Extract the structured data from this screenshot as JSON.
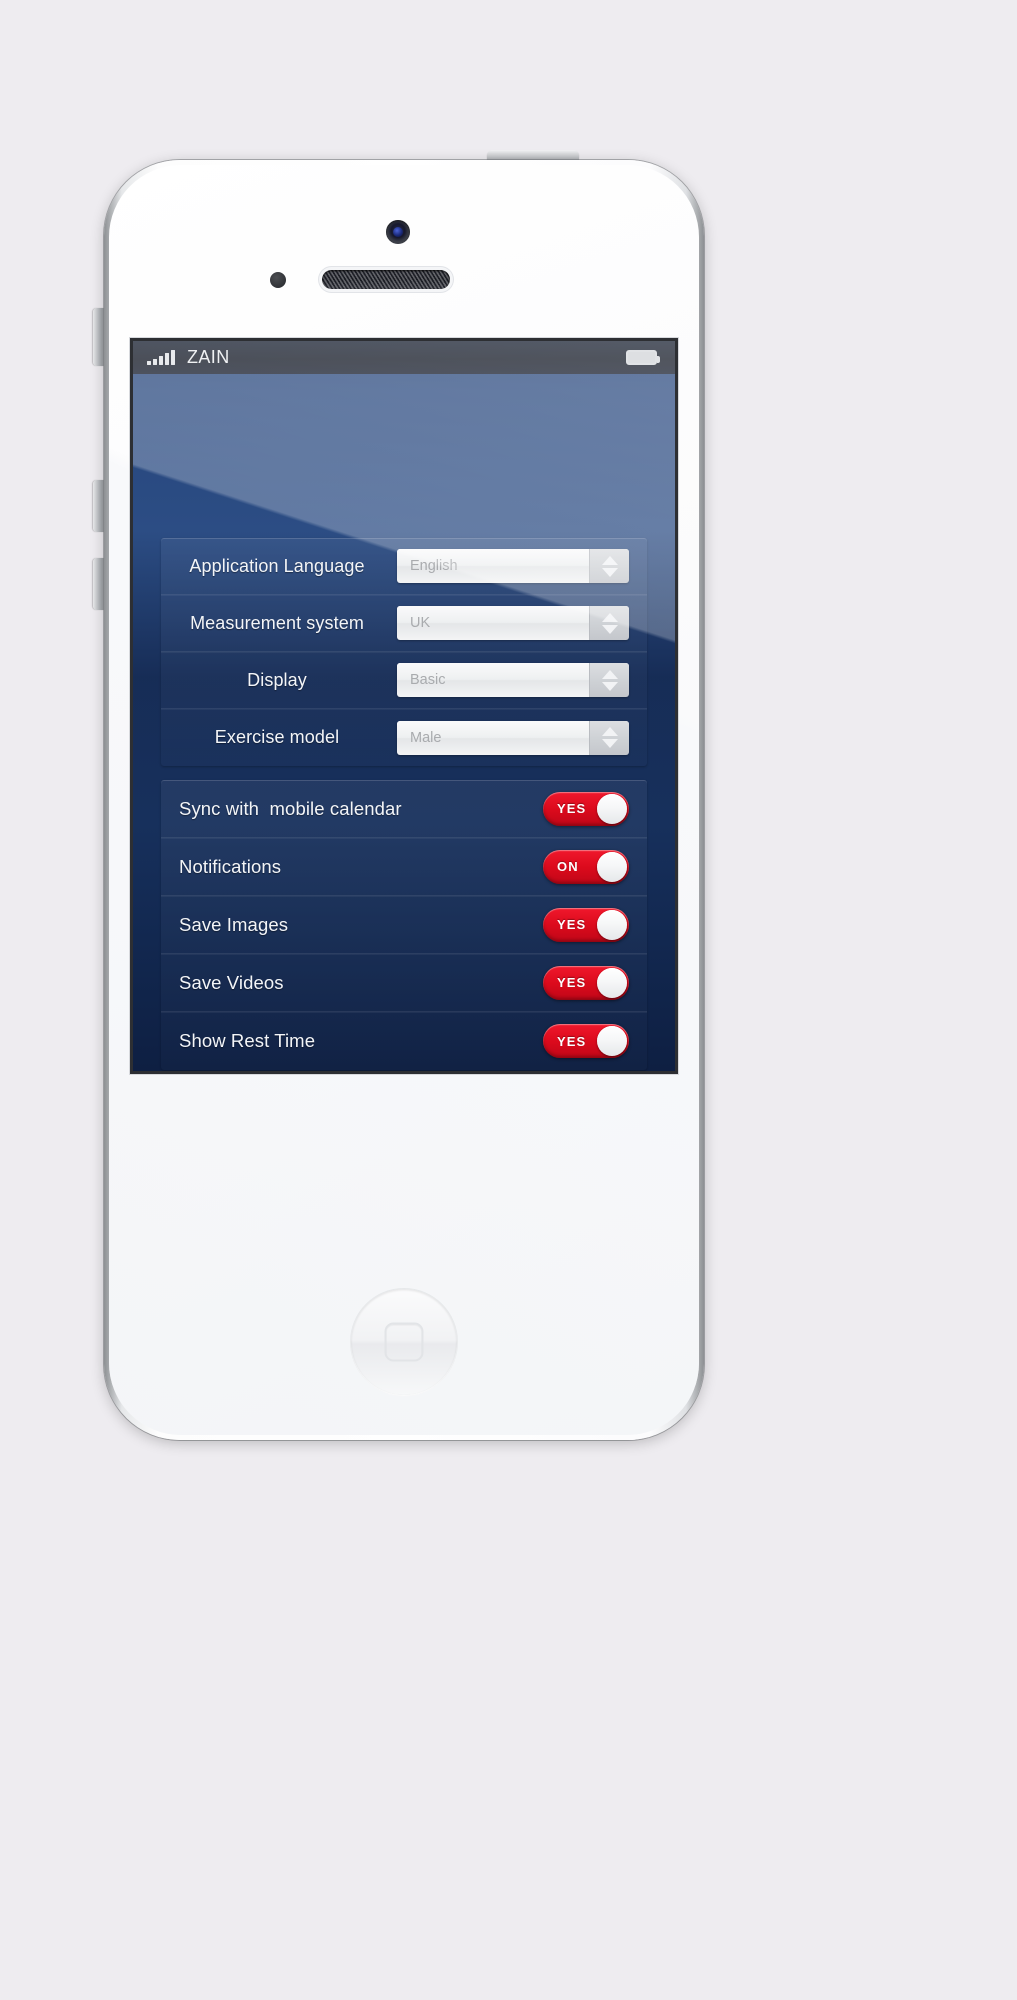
{
  "status_bar": {
    "signal_icon": "signal-bars-icon",
    "signal_bars": 5,
    "carrier": "ZAIN",
    "battery_icon": "battery-icon"
  },
  "settings": {
    "select_group": [
      {
        "label": "Application Language",
        "value": "English",
        "stepper_icon": "stepper-arrows-icon"
      },
      {
        "label": "Measurement system",
        "value": "UK",
        "stepper_icon": "stepper-arrows-icon"
      },
      {
        "label": "Display",
        "value": "Basic",
        "stepper_icon": "stepper-arrows-icon"
      },
      {
        "label": "Exercise model",
        "value": "Male",
        "stepper_icon": "stepper-arrows-icon"
      }
    ],
    "toggle_group": [
      {
        "label": "Sync with  mobile calendar",
        "state": "YES"
      },
      {
        "label": "Notifications",
        "state": "ON"
      },
      {
        "label": "Save Images",
        "state": "YES"
      },
      {
        "label": "Save Videos",
        "state": "YES"
      },
      {
        "label": "Show Rest Time",
        "state": "YES"
      }
    ]
  },
  "device": {
    "camera_icon": "front-camera-icon",
    "sensor_icon": "proximity-sensor-icon",
    "earpiece_icon": "earpiece-speaker-icon",
    "home_button_icon": "home-button-icon",
    "power_button_icon": "power-button-icon",
    "mute_switch_icon": "mute-switch-icon",
    "volume_up_icon": "volume-up-icon",
    "volume_down_icon": "volume-down-icon"
  },
  "colors": {
    "page_background": "#eeecf0",
    "screen_top": "#2c4d84",
    "screen_bottom": "#0e1f42",
    "toggle_on": "#db0a1c",
    "status_bar": "#070d1a",
    "label_text": "#f3f5f8",
    "select_value_text": "#a9abae"
  }
}
